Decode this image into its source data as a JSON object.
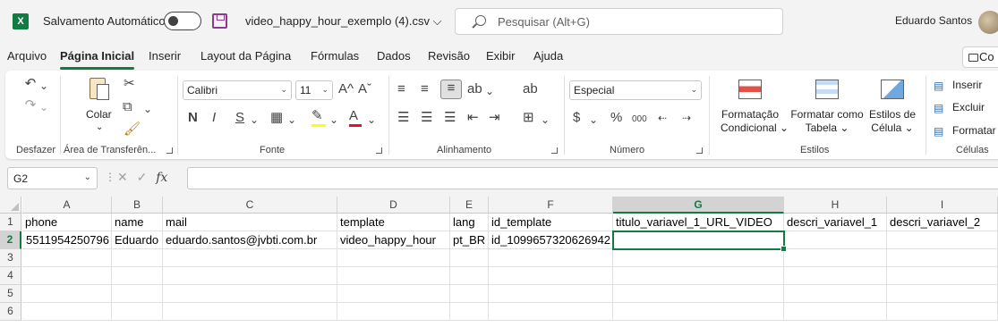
{
  "title_bar": {
    "app_icon_letter": "X",
    "autosave_label": "Salvamento Automático",
    "filename": "video_happy_hour_exemplo (4).csv",
    "filename_chevron": "⌵",
    "search_placeholder": "Pesquisar (Alt+G)",
    "user_name": "Eduardo Santos"
  },
  "menu_tabs": [
    "Arquivo",
    "Página Inicial",
    "Inserir",
    "Layout da Página",
    "Fórmulas",
    "Dados",
    "Revisão",
    "Exibir",
    "Ajuda"
  ],
  "comments_button_label": "Co",
  "ribbon": {
    "undo_group_label": "Desfazer",
    "clipboard": {
      "paste_label": "Colar",
      "paste_chevron": "⌄",
      "group_label": "Área de Transferên..."
    },
    "font": {
      "font_name": "Calibri",
      "font_size": "11",
      "grow_label": "A^",
      "shrink_label": "Aˇ",
      "bold": "N",
      "italic": "I",
      "underline": "S",
      "group_label": "Fonte"
    },
    "alignment": {
      "group_label": "Alinhamento"
    },
    "number": {
      "format": "Especial",
      "percent": "%",
      "thousands": "000",
      "group_label": "Número"
    },
    "styles": {
      "conditional_line1": "Formatação",
      "conditional_line2": "Condicional ⌄",
      "table_line1": "Formatar como",
      "table_line2": "Tabela ⌄",
      "cell_styles_line1": "Estilos de",
      "cell_styles_line2": "Célula ⌄",
      "group_label": "Estilos"
    },
    "cells": {
      "insert": "Inserir",
      "delete": "Excluir",
      "format": "Formatar",
      "group_label": "Células"
    }
  },
  "formula_bar": {
    "name_box": "G2",
    "cancel_symbol": "✕",
    "enter_symbol": "✓",
    "fx_label": "fx",
    "formula": ""
  },
  "grid": {
    "columns": [
      "A",
      "B",
      "C",
      "D",
      "E",
      "F",
      "G",
      "H",
      "I"
    ],
    "selected_column": "G",
    "rows": [
      "1",
      "2",
      "3",
      "4",
      "5",
      "6"
    ],
    "selected_row": "2",
    "row1": [
      "phone",
      "name",
      "mail",
      "template",
      "lang",
      "id_template",
      "titulo_variavel_1_URL_VIDEO",
      "descri_variavel_1",
      "descri_variavel_2"
    ],
    "row2": [
      "5511954250796",
      "Eduardo",
      "eduardo.santos@jvbti.com.br",
      "video_happy_hour",
      "pt_BR",
      "id_1099657320626942",
      "",
      "",
      ""
    ]
  },
  "colors": {
    "accent": "#107c41",
    "save_icon": "#8a3b8f",
    "font_color_bar": "#e81123",
    "highlight_bar": "#ffff00"
  },
  "icons": [
    "excel-logo-icon",
    "save-icon",
    "search-icon",
    "undo-icon",
    "redo-icon",
    "paste-icon",
    "cut-icon",
    "copy-icon",
    "format-painter-icon",
    "borders-icon",
    "fill-color-icon",
    "font-color-icon",
    "wrap-text-icon",
    "merge-icon",
    "currency-icon",
    "conditional-format-icon",
    "format-table-icon",
    "cell-styles-icon",
    "insert-cells-icon",
    "delete-cells-icon",
    "format-cells-icon"
  ]
}
